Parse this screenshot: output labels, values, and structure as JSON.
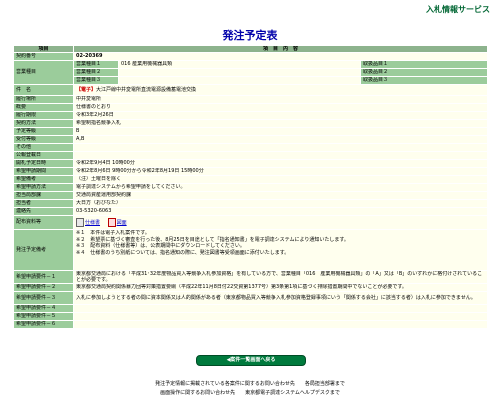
{
  "site_name": "入札情報サービス",
  "page_title": "発注予定表",
  "table_headers": {
    "item": "項目",
    "content": "項　目　内　容"
  },
  "rows": {
    "contract_no": {
      "label": "契約番号",
      "value": "02-20369"
    },
    "business_type_label": "営業種目",
    "business_types": [
      {
        "label": "営業種目１",
        "value": "016 産業用機械器具類",
        "rank_label": "取扱品目１"
      },
      {
        "label": "営業種目２",
        "value": "",
        "rank_label": "取扱品目２"
      },
      {
        "label": "営業種目３",
        "value": "",
        "rank_label": "取扱品目３"
      }
    ],
    "subject": {
      "label": "件　名",
      "tag": "【電子】",
      "value": "大江戸線中井変電所直流電源設備蓄電池交換"
    },
    "place": {
      "label": "履行場所",
      "value": "中井変電所"
    },
    "summary": {
      "label": "概要",
      "value": "仕様書のとおり"
    },
    "period": {
      "label": "履行期限",
      "value": "令和3年2月26日"
    },
    "method": {
      "label": "契約方法",
      "value": "希望制指名競争入札"
    },
    "grade": {
      "label": "予定等級",
      "value": "B"
    },
    "eligible": {
      "label": "受付等級",
      "value": "A,B"
    },
    "other": {
      "label": "その他",
      "value": ""
    },
    "announce_date": {
      "label": "公報登載日",
      "value": ""
    },
    "open_date": {
      "label": "開札予定日時",
      "value": "令和2年9月4日 10時00分"
    },
    "apply_period": {
      "label": "希望申請期間",
      "value": "令和2年8月6日 9時00分から令和2年8月19日 15時00分"
    },
    "apply_notes": {
      "label": "希望備考",
      "value": "（注）土曜日を除く"
    },
    "apply_method": {
      "label": "希望申請方法",
      "value": "電子調達システムから希望申請をしてください。"
    },
    "department": {
      "label": "担当局部課",
      "value": "交通局資産運用部契約課"
    },
    "person": {
      "label": "担当者",
      "value": "大日方（おびなた）"
    },
    "contact": {
      "label": "連絡先",
      "value": "03-5320-6063"
    },
    "documents": {
      "label": "配布資料等",
      "link1": "仕様書",
      "link2": "図面"
    },
    "order_notes": {
      "label": "発注予定備考",
      "lines": [
        "※１　本件は電子入札案件です。",
        "※２　希望票に基づく審査を行った後、8月25日を目途として「指名通知書」を電子調達システムにより通知いたします。",
        "※３　配布資料（仕様書等）は、公表期間中にダウンロードしてください。",
        "※４　仕様書のうち別紙については、指名通知の際に、発注図書等受領画面に添付いたします。"
      ]
    },
    "requirements": [
      {
        "label": "希望申請要件－１",
        "value": "東京都交通局における「平成31･32年度物品買入等競争入札参加資格」を有している方で、営業種目「016　産業用機械器具類」の「A」又は「B」のいずれかに格付けされていることが必要です。"
      },
      {
        "label": "希望申請要件－２",
        "value": "東京都交通局契約関係暴力団等対策措置要綱（平成22年11月8日付22交資第1377号）第3条第1項に基づく排除措置期間中でないことが必要です。"
      },
      {
        "label": "希望申請要件－３",
        "value": "入札に参加しようとする者の間に資本関係又は人的関係がある者（東京都物品買入等競争入札参加資格登録事項にいう「関係する会社」に該当する者）は入札に参加できません。"
      },
      {
        "label": "希望申請要件－４",
        "value": ""
      },
      {
        "label": "希望申請要件－５",
        "value": ""
      },
      {
        "label": "希望申請要件－６",
        "value": ""
      }
    ]
  },
  "back_button": "◀案件一覧画面へ戻る",
  "footer": {
    "line1": "発注予定情報に掲載されている各案件に関するお問い合わせ先　　各局担当部署まで",
    "line2": "画面操作に関するお問い合わせ先　　東京都電子調達システムヘルプデスクまで"
  },
  "colors": {
    "header": "#8db38d",
    "label": "#9bcc9b",
    "value": "#ffffee",
    "title": "#0000aa",
    "button": "#007a3d"
  },
  "icons": {
    "spec_doc": "document-icon",
    "drawing_doc": "pdf-icon"
  }
}
